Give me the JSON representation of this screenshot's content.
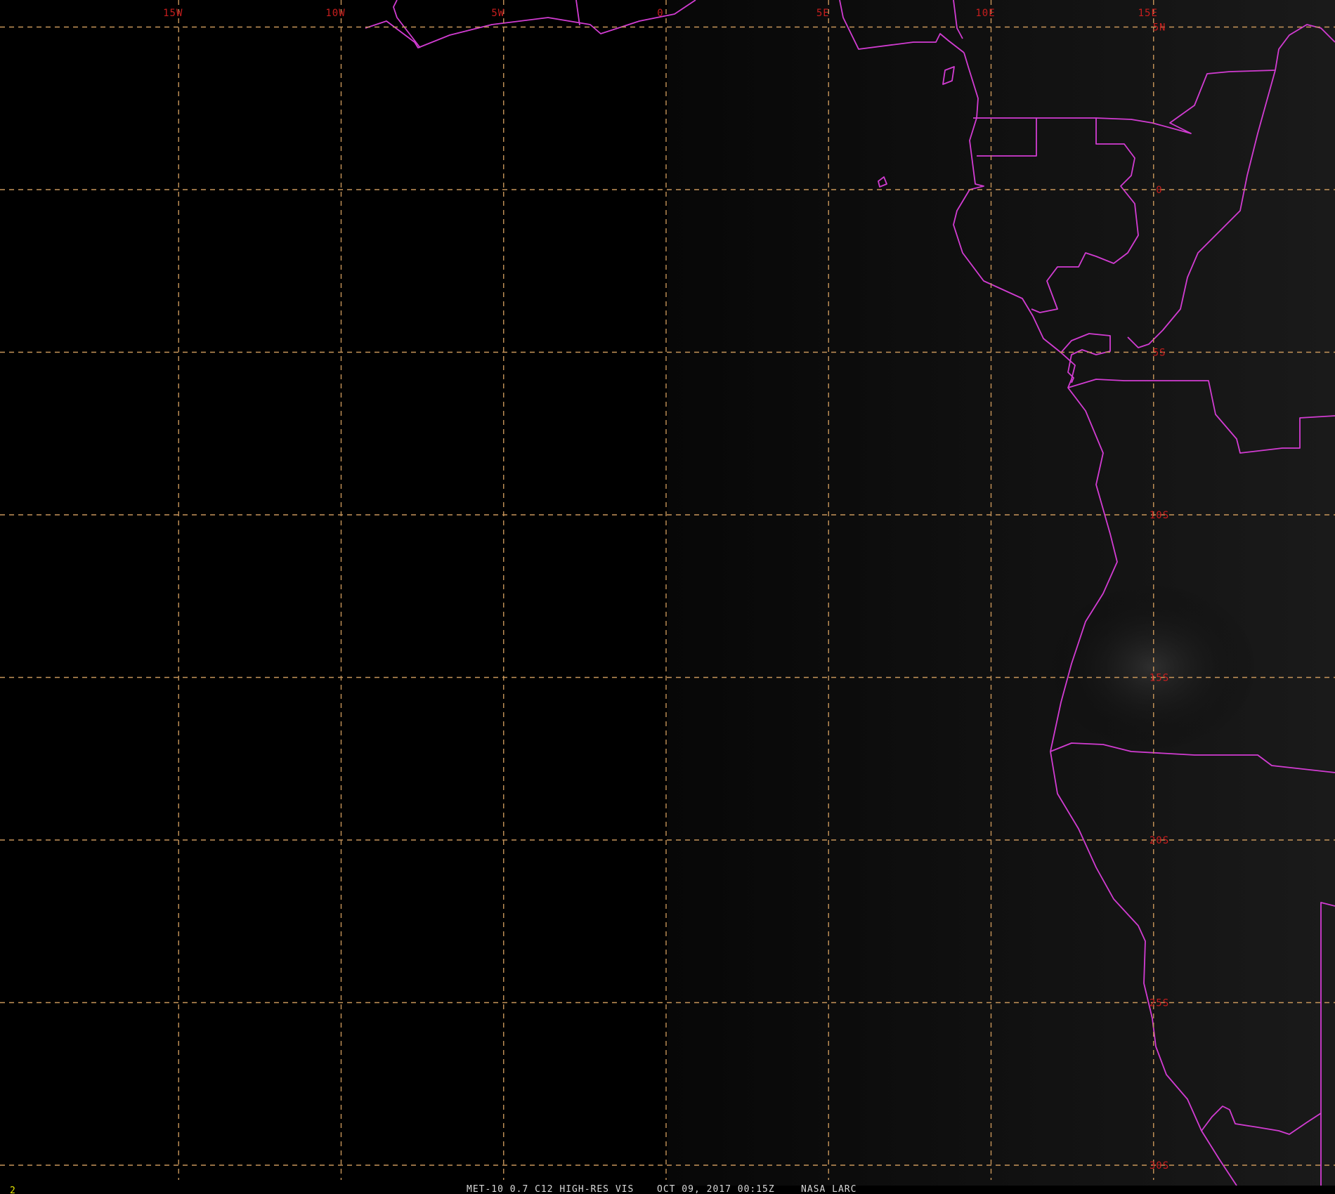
{
  "map": {
    "longitude_labels": [
      "15W",
      "10W",
      "5W",
      "0",
      "5E",
      "10E",
      "15E"
    ],
    "latitude_labels": [
      "5N",
      "0",
      "5S",
      "10S",
      "15S",
      "20S",
      "25S",
      "30S"
    ],
    "longitudes": [
      -15,
      -10,
      -5,
      0,
      5,
      10,
      15
    ],
    "latitudes": [
      5,
      0,
      -5,
      -10,
      -15,
      -20,
      -25,
      -30
    ],
    "colors": {
      "background": "#000000",
      "grid": "#c8965a",
      "labels": "#c81e1e",
      "boundaries": "#d23cd2",
      "footer_text": "#d8d8d8",
      "frame_number": "#e6e600"
    }
  },
  "footer": {
    "frame_number": "2",
    "product": "MET-10 0.7 C12 HIGH-RES VIS",
    "timestamp": "OCT 09, 2017 00:15Z",
    "source": "NASA LARC"
  }
}
